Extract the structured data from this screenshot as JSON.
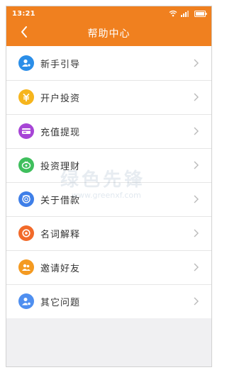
{
  "status_bar": {
    "time": "13:21",
    "icons": [
      "wifi-icon",
      "signal-icon",
      "battery-icon"
    ]
  },
  "header": {
    "title": "帮助中心",
    "back_icon": "chevron-left-icon"
  },
  "colors": {
    "brand": "#f0801f",
    "background": "#f0f0f2",
    "text": "#333333"
  },
  "menu": {
    "items": [
      {
        "label": "新手引导",
        "icon": "beginner-guide-icon",
        "color": "#2b8ee8"
      },
      {
        "label": "开户投资",
        "icon": "open-account-icon",
        "color": "#f6b51d"
      },
      {
        "label": "充值提现",
        "icon": "recharge-withdraw-icon",
        "color": "#a745d6"
      },
      {
        "label": "投资理财",
        "icon": "investment-icon",
        "color": "#3fbf5d"
      },
      {
        "label": "关于借款",
        "icon": "loan-icon",
        "color": "#3f7fe8"
      },
      {
        "label": "名词解释",
        "icon": "glossary-icon",
        "color": "#f26a2a"
      },
      {
        "label": "邀请好友",
        "icon": "invite-friends-icon",
        "color": "#f49a21"
      },
      {
        "label": "其它问题",
        "icon": "other-questions-icon",
        "color": "#4f8ff0"
      }
    ]
  },
  "watermark": {
    "text": "绿色先锋",
    "url": "www.greenxf.com"
  }
}
